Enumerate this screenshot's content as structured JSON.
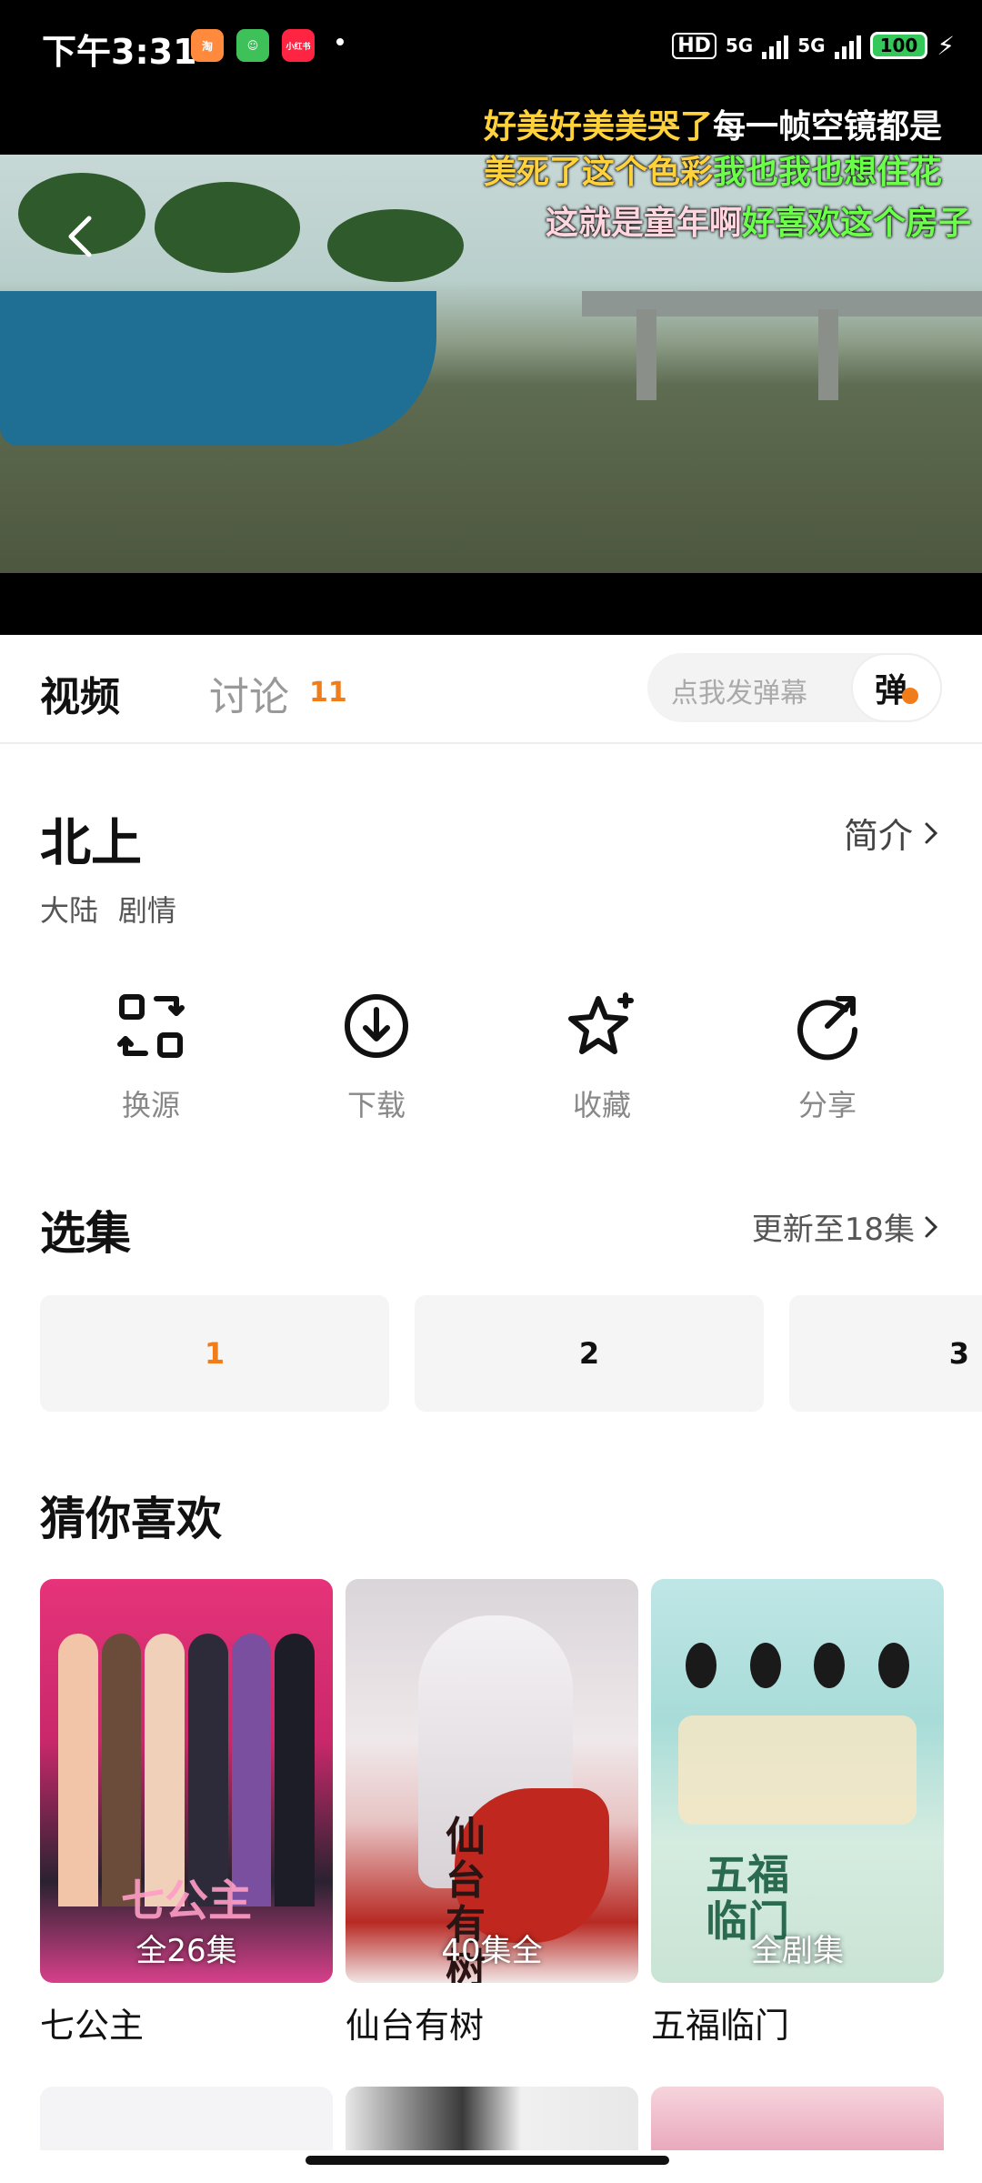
{
  "status_bar": {
    "time": "下午3:31",
    "app_badge_3": "小红书",
    "hd": "HD",
    "net1": "5G",
    "net2": "5G",
    "battery": "100"
  },
  "danmaku": [
    {
      "text_a": "好美好美美哭了",
      "text_b": "每一帧空镜都是"
    },
    {
      "text_a": "美死了这个色彩",
      "text_b": "我也我也想住花"
    },
    {
      "text_a": "这就是童年啊",
      "text_b": "好喜欢这个房子"
    }
  ],
  "tabs": {
    "video": "视频",
    "discuss": "讨论",
    "discuss_count": "11",
    "danmu_placeholder": "点我发弹幕",
    "danmu_button": "弹"
  },
  "show": {
    "title": "北上",
    "intro": "简介",
    "tags": [
      "大陆",
      "剧情"
    ]
  },
  "actions": [
    {
      "label": "换源",
      "icon": "swap-source-icon"
    },
    {
      "label": "下载",
      "icon": "download-icon"
    },
    {
      "label": "收藏",
      "icon": "star-icon"
    },
    {
      "label": "分享",
      "icon": "share-icon"
    }
  ],
  "episodes": {
    "title": "选集",
    "update": "更新至18集",
    "items": [
      {
        "label": "1",
        "selected": true
      },
      {
        "label": "2",
        "selected": false
      },
      {
        "label": "3",
        "selected": false
      }
    ]
  },
  "recommend": {
    "title": "猜你喜欢",
    "items": [
      {
        "name": "七公主",
        "badge": "全26集",
        "poster_text": "七公主"
      },
      {
        "name": "仙台有树",
        "badge": "40集全",
        "poster_text": "仙台有树"
      },
      {
        "name": "五福临门",
        "badge": "全剧集",
        "poster_text": "五福临门"
      }
    ]
  },
  "colors": {
    "accent_orange": "#f07d1a",
    "danmaku_yellow": "#ffd23c",
    "danmaku_green": "#6bff4a",
    "danmaku_pink": "#ffd6df"
  }
}
